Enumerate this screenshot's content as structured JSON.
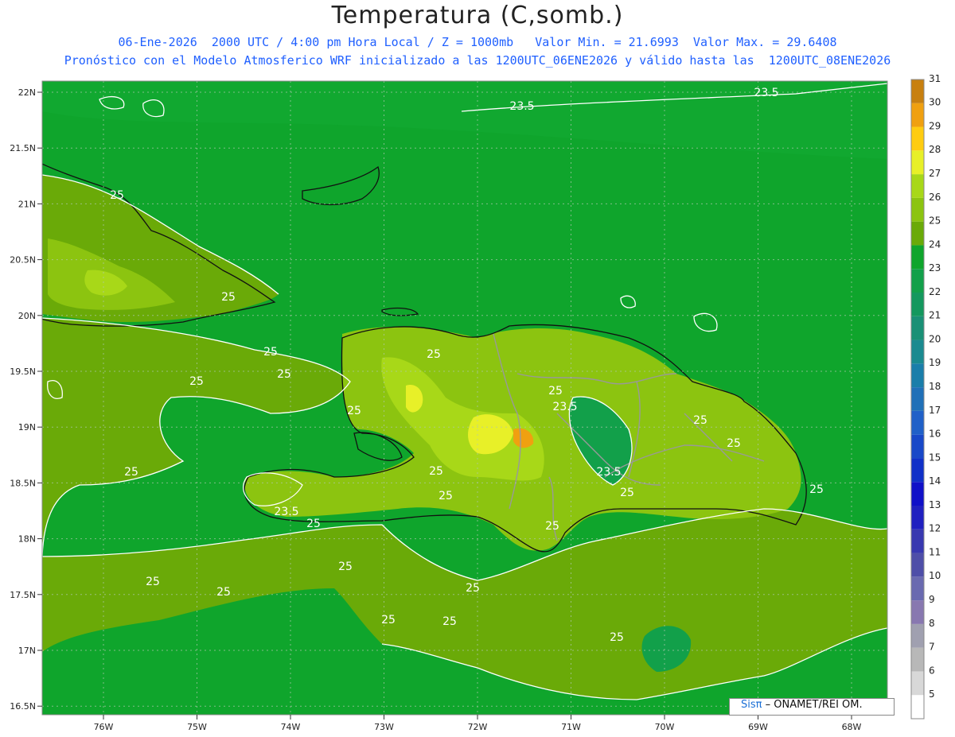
{
  "header": {
    "title": "Temperatura (C,somb.)",
    "line1": "06-Ene-2026  2000 UTC / 4:00 pm Hora Local / Z = 1000mb   Valor Min. = 21.6993  Valor Max. = 29.6408",
    "line2": "Pronóstico con el Modelo Atmosferico WRF inicializado a las 1200UTC_06ENE2026 y válido hasta las  1200UTC_08ENE2026"
  },
  "lat_labels": [
    "22N",
    "21.5N",
    "21N",
    "20.5N",
    "20N",
    "19.5N",
    "19N",
    "18.5N",
    "18N",
    "17.5N",
    "17N",
    "16.5N"
  ],
  "lon_labels": [
    "76W",
    "75W",
    "74W",
    "73W",
    "72W",
    "71W",
    "70W",
    "69W",
    "68W"
  ],
  "colorbar": {
    "labels": [
      "5",
      "6",
      "7",
      "8",
      "9",
      "10",
      "11",
      "12",
      "13",
      "14",
      "15",
      "16",
      "17",
      "18",
      "19",
      "20",
      "21",
      "22",
      "23",
      "24",
      "25",
      "26",
      "27",
      "28",
      "29",
      "30",
      "31"
    ],
    "colors": [
      "#ffffff",
      "#d8d8d8",
      "#b8b8b8",
      "#a0a0b0",
      "#8878b0",
      "#6a6ab0",
      "#4e4ea8",
      "#3838b0",
      "#2020c0",
      "#1010c8",
      "#1030c8",
      "#1848c8",
      "#2060c8",
      "#2070b8",
      "#1a7eaa",
      "#1a8a90",
      "#1a9076",
      "#14985e",
      "#12a04a",
      "#0fa52c",
      "#6aaa08",
      "#8cc410",
      "#a8d818",
      "#e8f028",
      "#ffcc10",
      "#f0a010",
      "#c88010"
    ]
  },
  "contour_labels": [
    "23.5",
    "23.5",
    "25",
    "25",
    "25",
    "25",
    "25",
    "25",
    "25",
    "25",
    "25",
    "25",
    "25",
    "25",
    "25",
    "25",
    "25",
    "25",
    "25",
    "25",
    "23.5",
    "23.5",
    "23.5",
    "25",
    "25",
    "25",
    "25",
    "25",
    "25"
  ],
  "map_colors": {
    "ocean": "#0fa52c",
    "warm": "#6aaa08",
    "warmer": "#8cc410",
    "hot": "#a8d818",
    "very_hot": "#e8f028",
    "hottest": "#f0a010",
    "cool": "#12a04a"
  },
  "credit": {
    "brand": "Sisπ",
    "text": "– ONAMET/REI  OM."
  }
}
